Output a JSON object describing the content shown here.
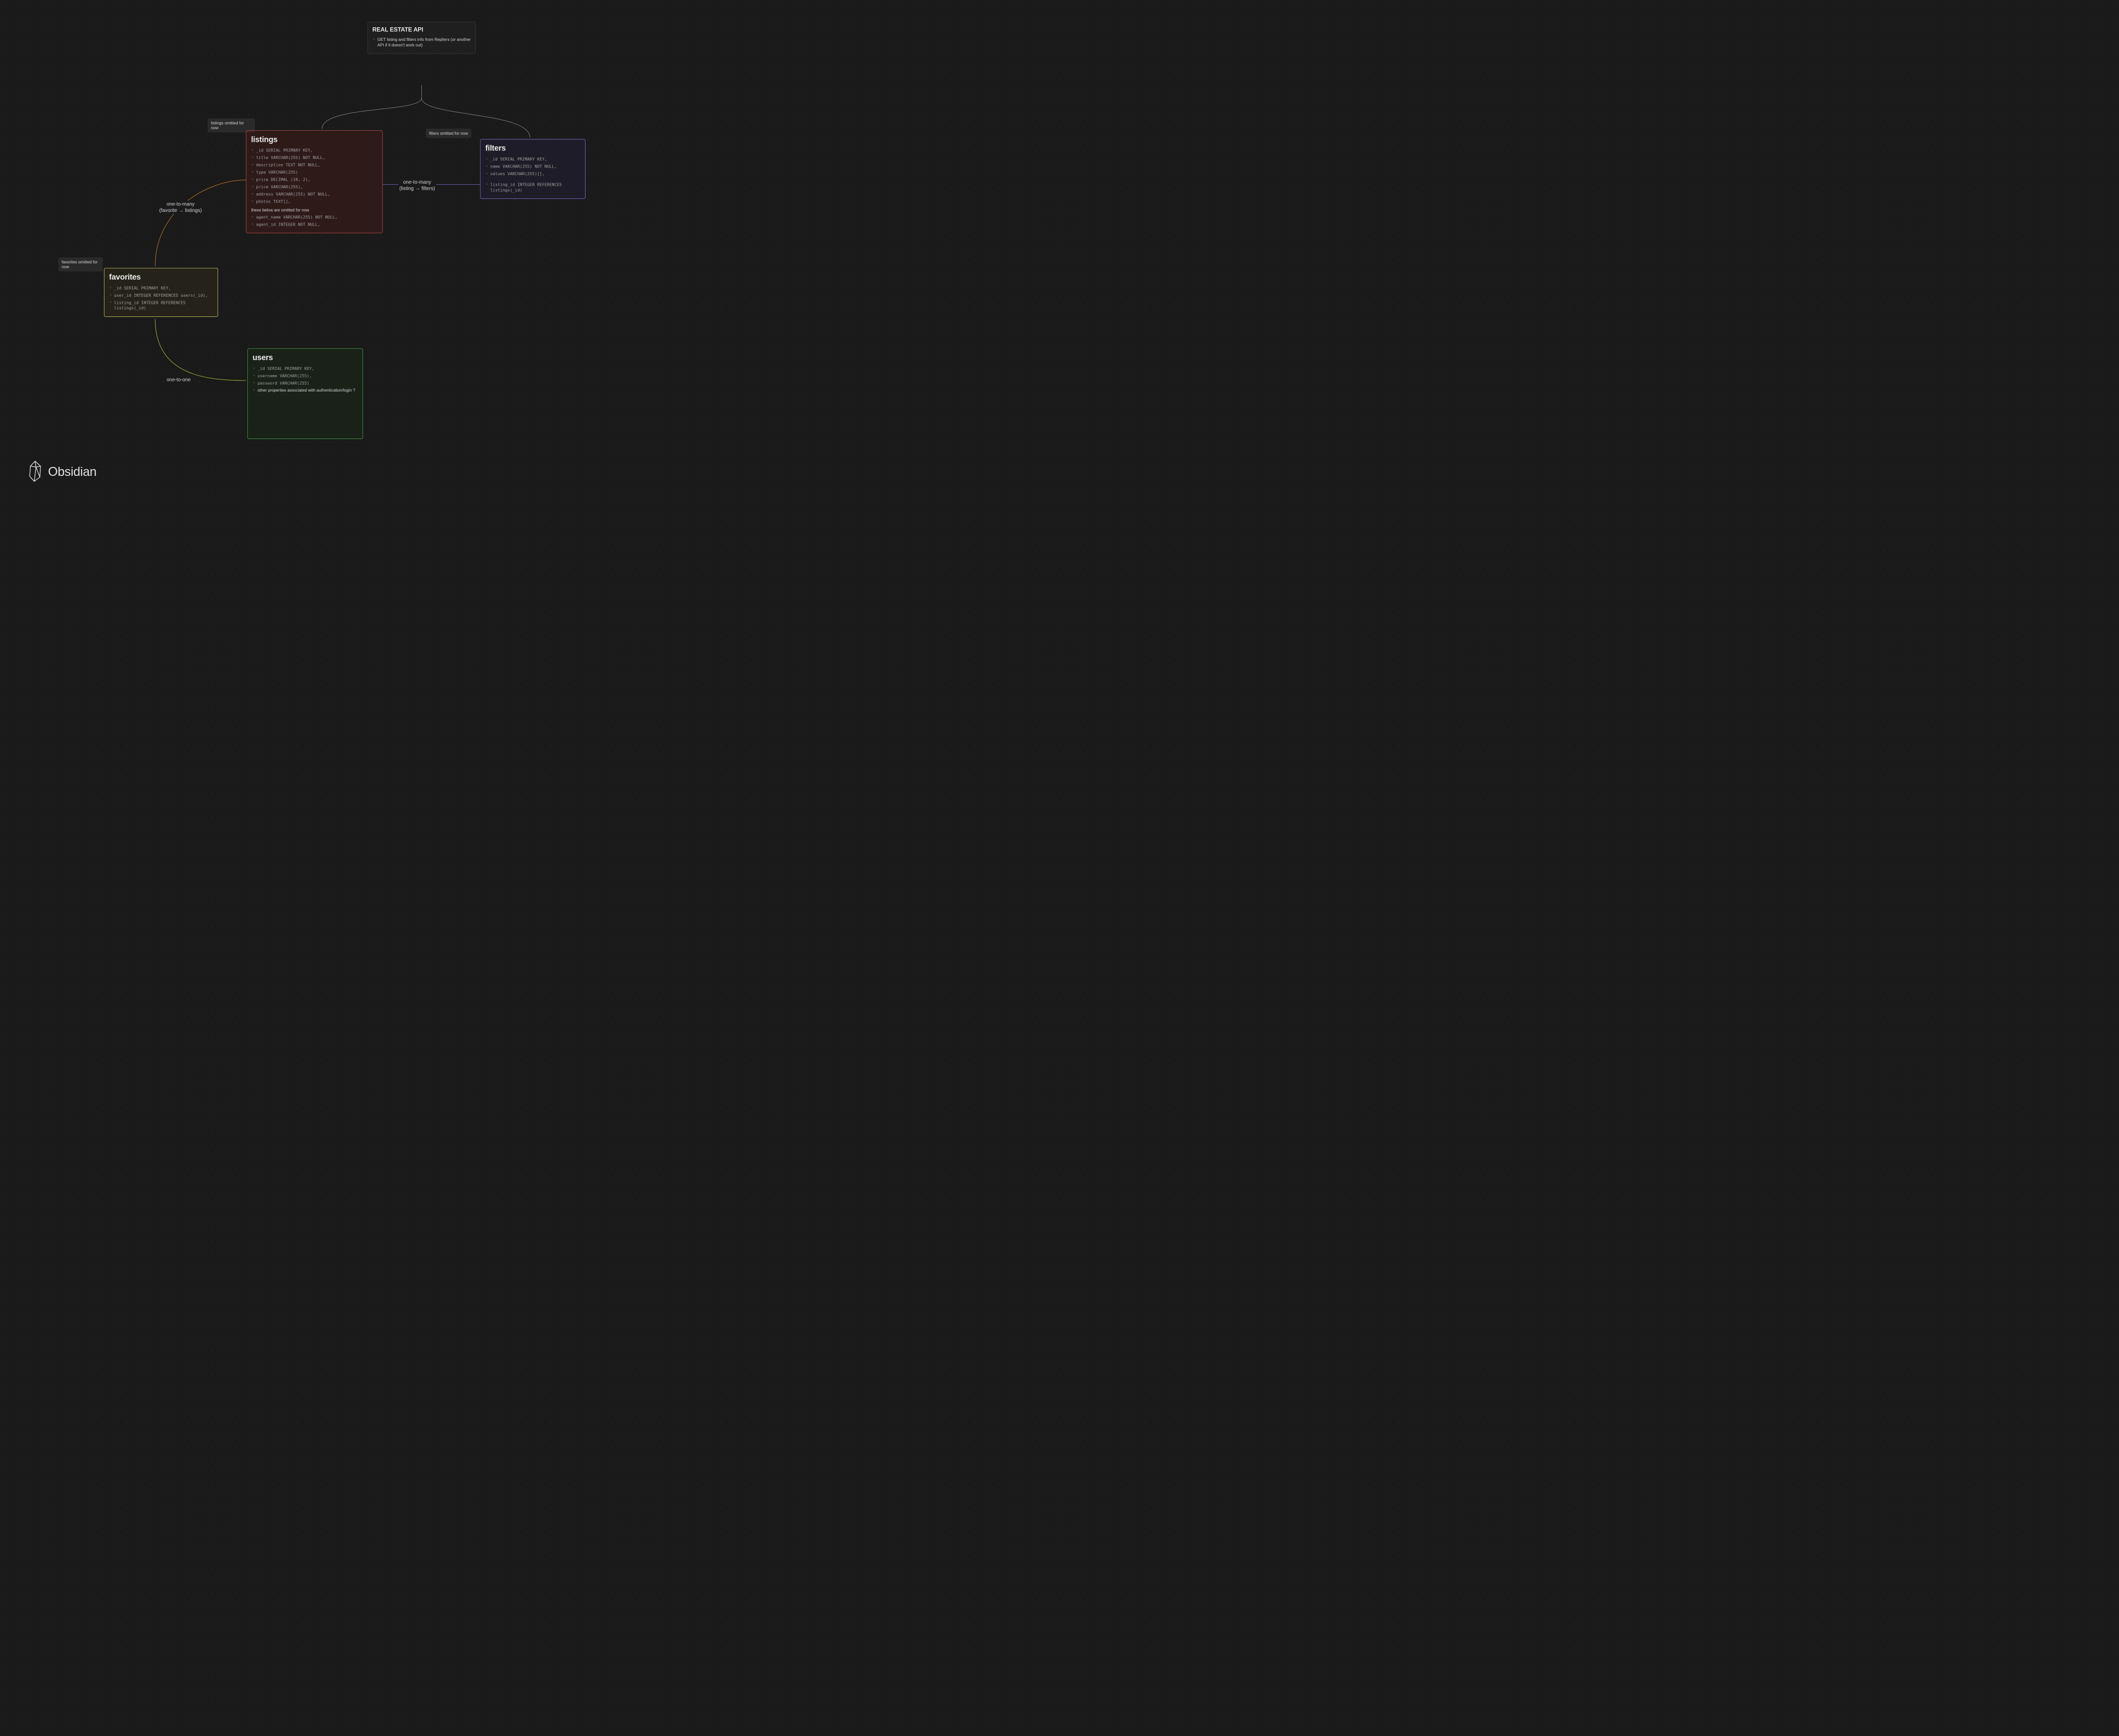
{
  "app": {
    "name": "Obsidian"
  },
  "nodes": {
    "api": {
      "title": "REAL ESTATE API",
      "items": [
        "GET listing and filters info from Repliers (or another API if it doesn't work out)"
      ]
    },
    "listings": {
      "title": "listings",
      "items_top": [
        "_id SERIAL PRIMARY KEY,",
        "title VARCHAR(255) NOT NULL,",
        "description TEXT NOT NULL,",
        "type VARCHAR(255)",
        "price DECIMAL (10, 2),",
        "price VARCHAR(255),",
        "address VARCHAR(255) NOT NULL,",
        "photos TEXT[],"
      ],
      "section_note": "these below are omitted for now",
      "items_bottom": [
        "agent_name VARCHAR(255) NOT NULL,",
        "agent_id INTEGER NOT NULL,"
      ]
    },
    "filters": {
      "title": "filters",
      "items_top": [
        "_id SERIAL PRIMARY KEY,",
        "name VARCHAR(255) NOT NULL,",
        "values VARCHAR(255)[],"
      ],
      "items_bottom": [
        "listing_id INTEGER REFERENCES listings(_id)"
      ]
    },
    "favorites": {
      "title": "favorites",
      "items": [
        "_id SERIAL PRIMARY KEY,",
        "user_id INTEGER REFERENCES users(_id),",
        "listing_id INTEGER REFERENCES listings(_id)"
      ]
    },
    "users": {
      "title": "users",
      "items": [
        "_id SERIAL PRIMARY KEY,",
        "username VARCHAR(255),",
        "password VARCHAR(255)"
      ],
      "prose_item": "other properties associated with authentication/login ?"
    }
  },
  "tags": {
    "listings_omitted": "listings omitted for now",
    "filters_omitted": "filters omitted for now",
    "favorites_omitted": "favorites omitted for now"
  },
  "edges": {
    "fav_to_listings": {
      "label_l1": "one-to-many",
      "label_l2": "(favorite → listings)"
    },
    "listing_to_filters": {
      "label_l1": "one-to-many",
      "label_l2": "(listing → filters)"
    },
    "fav_to_users": {
      "label": "one-to-one"
    }
  },
  "colors": {
    "red": "#b04a4a",
    "yellow": "#c8c860",
    "green": "#4aa04a",
    "purple": "#8070d0",
    "arrow_gray": "#888888",
    "orange_edge": "#d08030",
    "yellowgreen_edge": "#b8c840",
    "purple_edge": "#7860c0"
  }
}
